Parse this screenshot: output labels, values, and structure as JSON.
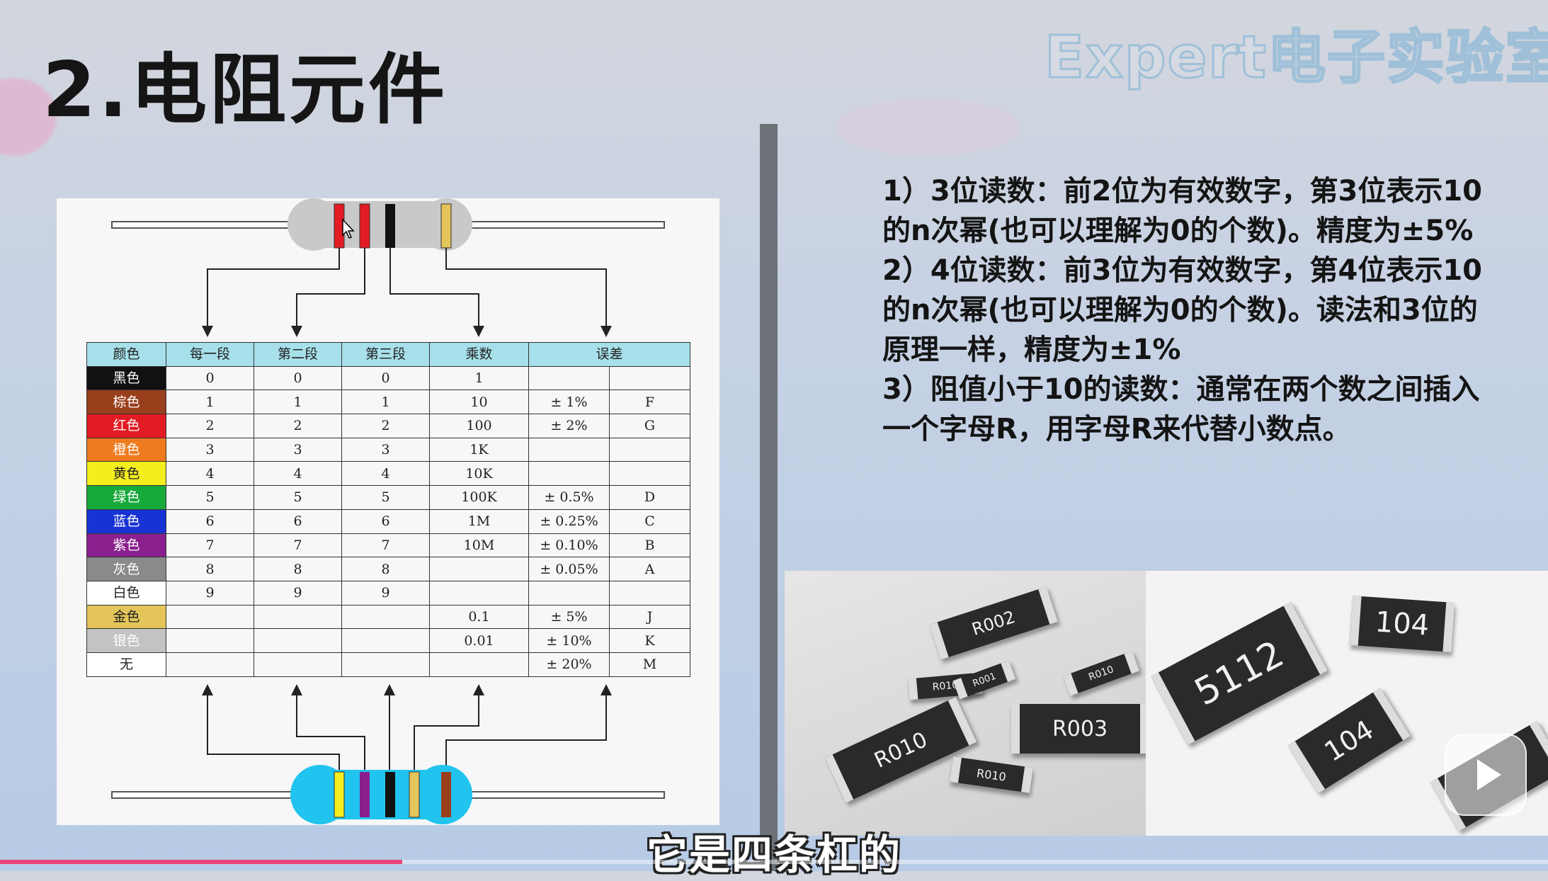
{
  "page_title": "2.电阻元件",
  "watermark": "Expert电子实验室",
  "colors": {
    "accent_pink": "#e8457a",
    "header_cyan": "#a7e0ea",
    "resistor_gray_body": "#c9c9c9",
    "resistor_blue_body": "#20c4ee"
  },
  "table": {
    "headers": [
      "颜色",
      "每一段",
      "第二段",
      "第三段",
      "乘数",
      "误差"
    ],
    "rows": [
      {
        "color": "黑色",
        "hex": "#111111",
        "text_light": false,
        "d1": "0",
        "d2": "0",
        "d3": "0",
        "mult": "1",
        "tol": "",
        "code": ""
      },
      {
        "color": "棕色",
        "hex": "#9a3f1c",
        "text_light": false,
        "d1": "1",
        "d2": "1",
        "d3": "1",
        "mult": "10",
        "tol": "± 1%",
        "code": "F"
      },
      {
        "color": "红色",
        "hex": "#e31b23",
        "text_light": false,
        "d1": "2",
        "d2": "2",
        "d3": "2",
        "mult": "100",
        "tol": "± 2%",
        "code": "G"
      },
      {
        "color": "橙色",
        "hex": "#f07b1e",
        "text_light": false,
        "d1": "3",
        "d2": "3",
        "d3": "3",
        "mult": "1K",
        "tol": "",
        "code": ""
      },
      {
        "color": "黄色",
        "hex": "#f5ee1f",
        "text_light": true,
        "d1": "4",
        "d2": "4",
        "d3": "4",
        "mult": "10K",
        "tol": "",
        "code": ""
      },
      {
        "color": "绿色",
        "hex": "#18a93b",
        "text_light": false,
        "d1": "5",
        "d2": "5",
        "d3": "5",
        "mult": "100K",
        "tol": "± 0.5%",
        "code": "D"
      },
      {
        "color": "蓝色",
        "hex": "#1833d4",
        "text_light": false,
        "d1": "6",
        "d2": "6",
        "d3": "6",
        "mult": "1M",
        "tol": "± 0.25%",
        "code": "C"
      },
      {
        "color": "紫色",
        "hex": "#8a1f8e",
        "text_light": false,
        "d1": "7",
        "d2": "7",
        "d3": "7",
        "mult": "10M",
        "tol": "± 0.10%",
        "code": "B"
      },
      {
        "color": "灰色",
        "hex": "#8a8a8a",
        "text_light": false,
        "d1": "8",
        "d2": "8",
        "d3": "8",
        "mult": "",
        "tol": "± 0.05%",
        "code": "A"
      },
      {
        "color": "白色",
        "hex": "#ffffff",
        "text_light": true,
        "d1": "9",
        "d2": "9",
        "d3": "9",
        "mult": "",
        "tol": "",
        "code": ""
      },
      {
        "color": "金色",
        "hex": "#e3c55a",
        "text_light": true,
        "d1": "",
        "d2": "",
        "d3": "",
        "mult": "0.1",
        "tol": "± 5%",
        "code": "J"
      },
      {
        "color": "银色",
        "hex": "#c3c3c3",
        "text_light": false,
        "d1": "",
        "d2": "",
        "d3": "",
        "mult": "0.01",
        "tol": "± 10%",
        "code": "K"
      },
      {
        "color": "无",
        "hex": "#ffffff",
        "text_light": true,
        "d1": "",
        "d2": "",
        "d3": "",
        "mult": "",
        "tol": "± 20%",
        "code": "M"
      }
    ]
  },
  "description": {
    "p1": "1）3位读数：前2位为有效数字，第3位表示10的n次幂(也可以理解为0的个数)。精度为±5%",
    "p2": "2）4位读数：前3位为有效数字，第4位表示10的n次幂(也可以理解为0的个数)。读法和3位的原理一样，精度为±1%",
    "p3": "3）阻值小于10的读数：通常在两个数之间插入一个字母R，用字母R来代替小数点。"
  },
  "chips_photo1": [
    "R002",
    "R010",
    "R001",
    "R010",
    "R003",
    "R010",
    "R010"
  ],
  "chips_photo2": [
    "5112",
    "104",
    "104"
  ],
  "subtitle": "它是四条杠的",
  "progress": 0.26
}
